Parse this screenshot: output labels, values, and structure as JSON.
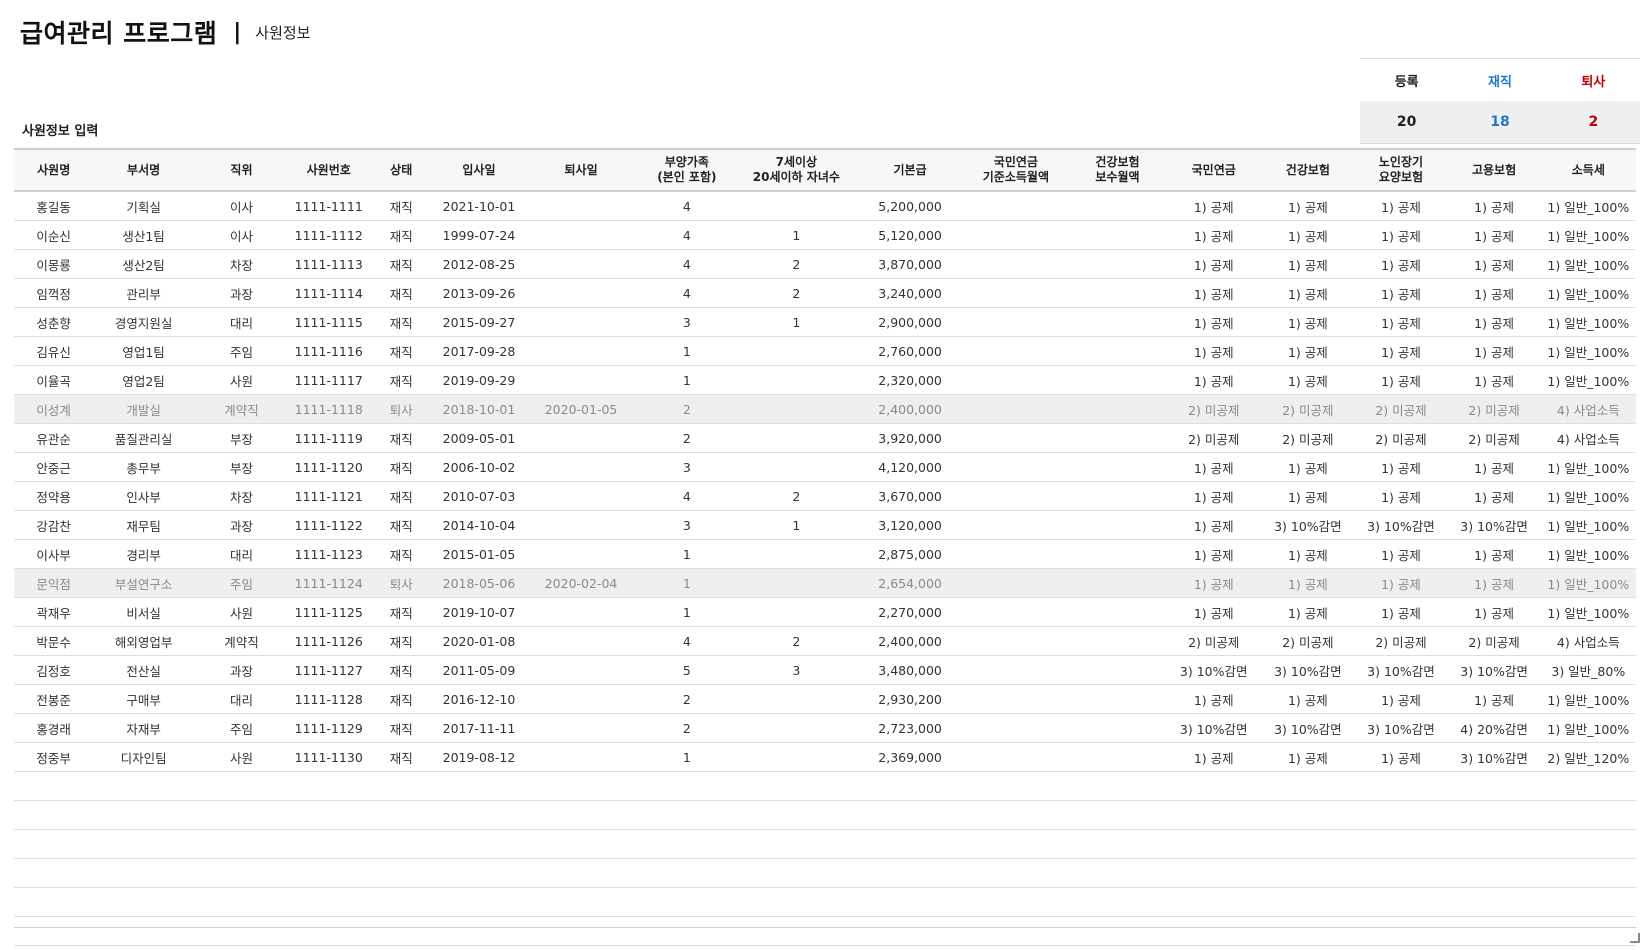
{
  "header": {
    "title": "급여관리 프로그램",
    "separator": "|",
    "subtitle": "사원정보"
  },
  "summary": {
    "registered_label": "등록",
    "active_label": "재직",
    "retired_label": "퇴사",
    "registered_count": "20",
    "active_count": "18",
    "retired_count": "2",
    "colors": {
      "active": "#1e7ac8",
      "retired": "#c00000"
    }
  },
  "section_label": "사원정보 입력",
  "table": {
    "columns": [
      "사원명",
      "부서명",
      "직위",
      "사원번호",
      "상태",
      "입사일",
      "퇴사일",
      "부양가족\n(본인 포함)",
      "7세이상\n20세이하 자녀수",
      "기본급",
      "국민연금\n기준소득월액",
      "건강보험\n보수월액",
      "국민연금",
      "건강보험",
      "노인장기\n요양보험",
      "고용보험",
      "소득세"
    ],
    "rows": [
      [
        "홍길동",
        "기획실",
        "이사",
        "1111-1111",
        "재직",
        "2021-10-01",
        "",
        "4",
        "",
        "5,200,000",
        "",
        "",
        "1) 공제",
        "1) 공제",
        "1) 공제",
        "1) 공제",
        "1) 일반_100%"
      ],
      [
        "이순신",
        "생산1팀",
        "이사",
        "1111-1112",
        "재직",
        "1999-07-24",
        "",
        "4",
        "1",
        "5,120,000",
        "",
        "",
        "1) 공제",
        "1) 공제",
        "1) 공제",
        "1) 공제",
        "1) 일반_100%"
      ],
      [
        "이몽룡",
        "생산2팀",
        "차장",
        "1111-1113",
        "재직",
        "2012-08-25",
        "",
        "4",
        "2",
        "3,870,000",
        "",
        "",
        "1) 공제",
        "1) 공제",
        "1) 공제",
        "1) 공제",
        "1) 일반_100%"
      ],
      [
        "임꺽정",
        "관리부",
        "과장",
        "1111-1114",
        "재직",
        "2013-09-26",
        "",
        "4",
        "2",
        "3,240,000",
        "",
        "",
        "1) 공제",
        "1) 공제",
        "1) 공제",
        "1) 공제",
        "1) 일반_100%"
      ],
      [
        "성춘향",
        "경영지원실",
        "대리",
        "1111-1115",
        "재직",
        "2015-09-27",
        "",
        "3",
        "1",
        "2,900,000",
        "",
        "",
        "1) 공제",
        "1) 공제",
        "1) 공제",
        "1) 공제",
        "1) 일반_100%"
      ],
      [
        "김유신",
        "영업1팀",
        "주임",
        "1111-1116",
        "재직",
        "2017-09-28",
        "",
        "1",
        "",
        "2,760,000",
        "",
        "",
        "1) 공제",
        "1) 공제",
        "1) 공제",
        "1) 공제",
        "1) 일반_100%"
      ],
      [
        "이율곡",
        "영업2팀",
        "사원",
        "1111-1117",
        "재직",
        "2019-09-29",
        "",
        "1",
        "",
        "2,320,000",
        "",
        "",
        "1) 공제",
        "1) 공제",
        "1) 공제",
        "1) 공제",
        "1) 일반_100%"
      ],
      [
        "이성계",
        "개발실",
        "계약직",
        "1111-1118",
        "퇴사",
        "2018-10-01",
        "2020-01-05",
        "2",
        "",
        "2,400,000",
        "",
        "",
        "2) 미공제",
        "2) 미공제",
        "2) 미공제",
        "2) 미공제",
        "4) 사업소득"
      ],
      [
        "유관순",
        "품질관리실",
        "부장",
        "1111-1119",
        "재직",
        "2009-05-01",
        "",
        "2",
        "",
        "3,920,000",
        "",
        "",
        "2) 미공제",
        "2) 미공제",
        "2) 미공제",
        "2) 미공제",
        "4) 사업소득"
      ],
      [
        "안중근",
        "총무부",
        "부장",
        "1111-1120",
        "재직",
        "2006-10-02",
        "",
        "3",
        "",
        "4,120,000",
        "",
        "",
        "1) 공제",
        "1) 공제",
        "1) 공제",
        "1) 공제",
        "1) 일반_100%"
      ],
      [
        "정약용",
        "인사부",
        "차장",
        "1111-1121",
        "재직",
        "2010-07-03",
        "",
        "4",
        "2",
        "3,670,000",
        "",
        "",
        "1) 공제",
        "1) 공제",
        "1) 공제",
        "1) 공제",
        "1) 일반_100%"
      ],
      [
        "강감찬",
        "재무팀",
        "과장",
        "1111-1122",
        "재직",
        "2014-10-04",
        "",
        "3",
        "1",
        "3,120,000",
        "",
        "",
        "1) 공제",
        "3) 10%감면",
        "3) 10%감면",
        "3) 10%감면",
        "1) 일반_100%"
      ],
      [
        "이사부",
        "경리부",
        "대리",
        "1111-1123",
        "재직",
        "2015-01-05",
        "",
        "1",
        "",
        "2,875,000",
        "",
        "",
        "1) 공제",
        "1) 공제",
        "1) 공제",
        "1) 공제",
        "1) 일반_100%"
      ],
      [
        "문익점",
        "부설연구소",
        "주임",
        "1111-1124",
        "퇴사",
        "2018-05-06",
        "2020-02-04",
        "1",
        "",
        "2,654,000",
        "",
        "",
        "1) 공제",
        "1) 공제",
        "1) 공제",
        "1) 공제",
        "1) 일반_100%"
      ],
      [
        "곽재우",
        "비서실",
        "사원",
        "1111-1125",
        "재직",
        "2019-10-07",
        "",
        "1",
        "",
        "2,270,000",
        "",
        "",
        "1) 공제",
        "1) 공제",
        "1) 공제",
        "1) 공제",
        "1) 일반_100%"
      ],
      [
        "박문수",
        "해외영업부",
        "계약직",
        "1111-1126",
        "재직",
        "2020-01-08",
        "",
        "4",
        "2",
        "2,400,000",
        "",
        "",
        "2) 미공제",
        "2) 미공제",
        "2) 미공제",
        "2) 미공제",
        "4) 사업소득"
      ],
      [
        "김정호",
        "전산실",
        "과장",
        "1111-1127",
        "재직",
        "2011-05-09",
        "",
        "5",
        "3",
        "3,480,000",
        "",
        "",
        "3) 10%감면",
        "3) 10%감면",
        "3) 10%감면",
        "3) 10%감면",
        "3) 일반_80%"
      ],
      [
        "전봉준",
        "구매부",
        "대리",
        "1111-1128",
        "재직",
        "2016-12-10",
        "",
        "2",
        "",
        "2,930,200",
        "",
        "",
        "1) 공제",
        "1) 공제",
        "1) 공제",
        "1) 공제",
        "1) 일반_100%"
      ],
      [
        "홍경래",
        "자재부",
        "주임",
        "1111-1129",
        "재직",
        "2017-11-11",
        "",
        "2",
        "",
        "2,723,000",
        "",
        "",
        "3) 10%감면",
        "3) 10%감면",
        "3) 10%감면",
        "4) 20%감면",
        "1) 일반_100%"
      ],
      [
        "정중부",
        "디자인팀",
        "사원",
        "1111-1130",
        "재직",
        "2019-08-12",
        "",
        "1",
        "",
        "2,369,000",
        "",
        "",
        "1) 공제",
        "1) 공제",
        "1) 공제",
        "3) 10%감면",
        "2) 일반_120%"
      ]
    ],
    "empty_rows": 6,
    "colors": {
      "retired_status": "#c00000",
      "retired_row_bg": "#efefef"
    }
  }
}
